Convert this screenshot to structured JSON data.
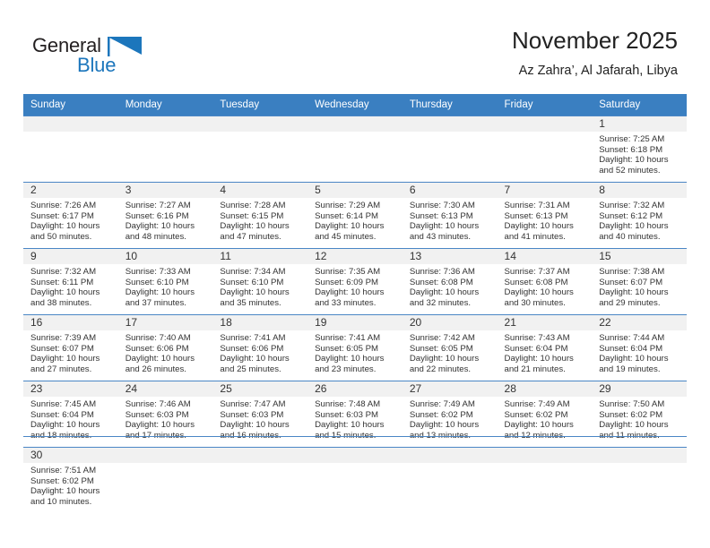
{
  "brand": {
    "name_top": "General",
    "name_bottom": "Blue",
    "flag_icon": "blue-triangle-flag",
    "color_dark": "#231f20",
    "color_blue": "#1c76bc"
  },
  "header": {
    "title": "November 2025",
    "subtitle": "Az Zahra’, Al Jafarah, Libya"
  },
  "theme": {
    "header_row_bg": "#3a7fc1",
    "grid_line": "#4a86c5",
    "daynum_band_bg": "#f1f1f1",
    "text": "#333333"
  },
  "calendar": {
    "weekday_headers": [
      "Sunday",
      "Monday",
      "Tuesday",
      "Wednesday",
      "Thursday",
      "Friday",
      "Saturday"
    ],
    "weeks": [
      [
        {
          "blank": true
        },
        {
          "blank": true
        },
        {
          "blank": true
        },
        {
          "blank": true
        },
        {
          "blank": true
        },
        {
          "blank": true
        },
        {
          "day": "1",
          "sunrise": "Sunrise: 7:25 AM",
          "sunset": "Sunset: 6:18 PM",
          "daylight1": "Daylight: 10 hours",
          "daylight2": "and 52 minutes."
        }
      ],
      [
        {
          "day": "2",
          "sunrise": "Sunrise: 7:26 AM",
          "sunset": "Sunset: 6:17 PM",
          "daylight1": "Daylight: 10 hours",
          "daylight2": "and 50 minutes."
        },
        {
          "day": "3",
          "sunrise": "Sunrise: 7:27 AM",
          "sunset": "Sunset: 6:16 PM",
          "daylight1": "Daylight: 10 hours",
          "daylight2": "and 48 minutes."
        },
        {
          "day": "4",
          "sunrise": "Sunrise: 7:28 AM",
          "sunset": "Sunset: 6:15 PM",
          "daylight1": "Daylight: 10 hours",
          "daylight2": "and 47 minutes."
        },
        {
          "day": "5",
          "sunrise": "Sunrise: 7:29 AM",
          "sunset": "Sunset: 6:14 PM",
          "daylight1": "Daylight: 10 hours",
          "daylight2": "and 45 minutes."
        },
        {
          "day": "6",
          "sunrise": "Sunrise: 7:30 AM",
          "sunset": "Sunset: 6:13 PM",
          "daylight1": "Daylight: 10 hours",
          "daylight2": "and 43 minutes."
        },
        {
          "day": "7",
          "sunrise": "Sunrise: 7:31 AM",
          "sunset": "Sunset: 6:13 PM",
          "daylight1": "Daylight: 10 hours",
          "daylight2": "and 41 minutes."
        },
        {
          "day": "8",
          "sunrise": "Sunrise: 7:32 AM",
          "sunset": "Sunset: 6:12 PM",
          "daylight1": "Daylight: 10 hours",
          "daylight2": "and 40 minutes."
        }
      ],
      [
        {
          "day": "9",
          "sunrise": "Sunrise: 7:32 AM",
          "sunset": "Sunset: 6:11 PM",
          "daylight1": "Daylight: 10 hours",
          "daylight2": "and 38 minutes."
        },
        {
          "day": "10",
          "sunrise": "Sunrise: 7:33 AM",
          "sunset": "Sunset: 6:10 PM",
          "daylight1": "Daylight: 10 hours",
          "daylight2": "and 37 minutes."
        },
        {
          "day": "11",
          "sunrise": "Sunrise: 7:34 AM",
          "sunset": "Sunset: 6:10 PM",
          "daylight1": "Daylight: 10 hours",
          "daylight2": "and 35 minutes."
        },
        {
          "day": "12",
          "sunrise": "Sunrise: 7:35 AM",
          "sunset": "Sunset: 6:09 PM",
          "daylight1": "Daylight: 10 hours",
          "daylight2": "and 33 minutes."
        },
        {
          "day": "13",
          "sunrise": "Sunrise: 7:36 AM",
          "sunset": "Sunset: 6:08 PM",
          "daylight1": "Daylight: 10 hours",
          "daylight2": "and 32 minutes."
        },
        {
          "day": "14",
          "sunrise": "Sunrise: 7:37 AM",
          "sunset": "Sunset: 6:08 PM",
          "daylight1": "Daylight: 10 hours",
          "daylight2": "and 30 minutes."
        },
        {
          "day": "15",
          "sunrise": "Sunrise: 7:38 AM",
          "sunset": "Sunset: 6:07 PM",
          "daylight1": "Daylight: 10 hours",
          "daylight2": "and 29 minutes."
        }
      ],
      [
        {
          "day": "16",
          "sunrise": "Sunrise: 7:39 AM",
          "sunset": "Sunset: 6:07 PM",
          "daylight1": "Daylight: 10 hours",
          "daylight2": "and 27 minutes."
        },
        {
          "day": "17",
          "sunrise": "Sunrise: 7:40 AM",
          "sunset": "Sunset: 6:06 PM",
          "daylight1": "Daylight: 10 hours",
          "daylight2": "and 26 minutes."
        },
        {
          "day": "18",
          "sunrise": "Sunrise: 7:41 AM",
          "sunset": "Sunset: 6:06 PM",
          "daylight1": "Daylight: 10 hours",
          "daylight2": "and 25 minutes."
        },
        {
          "day": "19",
          "sunrise": "Sunrise: 7:41 AM",
          "sunset": "Sunset: 6:05 PM",
          "daylight1": "Daylight: 10 hours",
          "daylight2": "and 23 minutes."
        },
        {
          "day": "20",
          "sunrise": "Sunrise: 7:42 AM",
          "sunset": "Sunset: 6:05 PM",
          "daylight1": "Daylight: 10 hours",
          "daylight2": "and 22 minutes."
        },
        {
          "day": "21",
          "sunrise": "Sunrise: 7:43 AM",
          "sunset": "Sunset: 6:04 PM",
          "daylight1": "Daylight: 10 hours",
          "daylight2": "and 21 minutes."
        },
        {
          "day": "22",
          "sunrise": "Sunrise: 7:44 AM",
          "sunset": "Sunset: 6:04 PM",
          "daylight1": "Daylight: 10 hours",
          "daylight2": "and 19 minutes."
        }
      ],
      [
        {
          "day": "23",
          "sunrise": "Sunrise: 7:45 AM",
          "sunset": "Sunset: 6:04 PM",
          "daylight1": "Daylight: 10 hours",
          "daylight2": "and 18 minutes."
        },
        {
          "day": "24",
          "sunrise": "Sunrise: 7:46 AM",
          "sunset": "Sunset: 6:03 PM",
          "daylight1": "Daylight: 10 hours",
          "daylight2": "and 17 minutes."
        },
        {
          "day": "25",
          "sunrise": "Sunrise: 7:47 AM",
          "sunset": "Sunset: 6:03 PM",
          "daylight1": "Daylight: 10 hours",
          "daylight2": "and 16 minutes."
        },
        {
          "day": "26",
          "sunrise": "Sunrise: 7:48 AM",
          "sunset": "Sunset: 6:03 PM",
          "daylight1": "Daylight: 10 hours",
          "daylight2": "and 15 minutes."
        },
        {
          "day": "27",
          "sunrise": "Sunrise: 7:49 AM",
          "sunset": "Sunset: 6:02 PM",
          "daylight1": "Daylight: 10 hours",
          "daylight2": "and 13 minutes."
        },
        {
          "day": "28",
          "sunrise": "Sunrise: 7:49 AM",
          "sunset": "Sunset: 6:02 PM",
          "daylight1": "Daylight: 10 hours",
          "daylight2": "and 12 minutes."
        },
        {
          "day": "29",
          "sunrise": "Sunrise: 7:50 AM",
          "sunset": "Sunset: 6:02 PM",
          "daylight1": "Daylight: 10 hours",
          "daylight2": "and 11 minutes."
        }
      ],
      [
        {
          "day": "30",
          "sunrise": "Sunrise: 7:51 AM",
          "sunset": "Sunset: 6:02 PM",
          "daylight1": "Daylight: 10 hours",
          "daylight2": "and 10 minutes."
        },
        {
          "empty": true
        },
        {
          "empty": true
        },
        {
          "empty": true
        },
        {
          "empty": true
        },
        {
          "empty": true
        },
        {
          "empty": true
        }
      ]
    ]
  }
}
